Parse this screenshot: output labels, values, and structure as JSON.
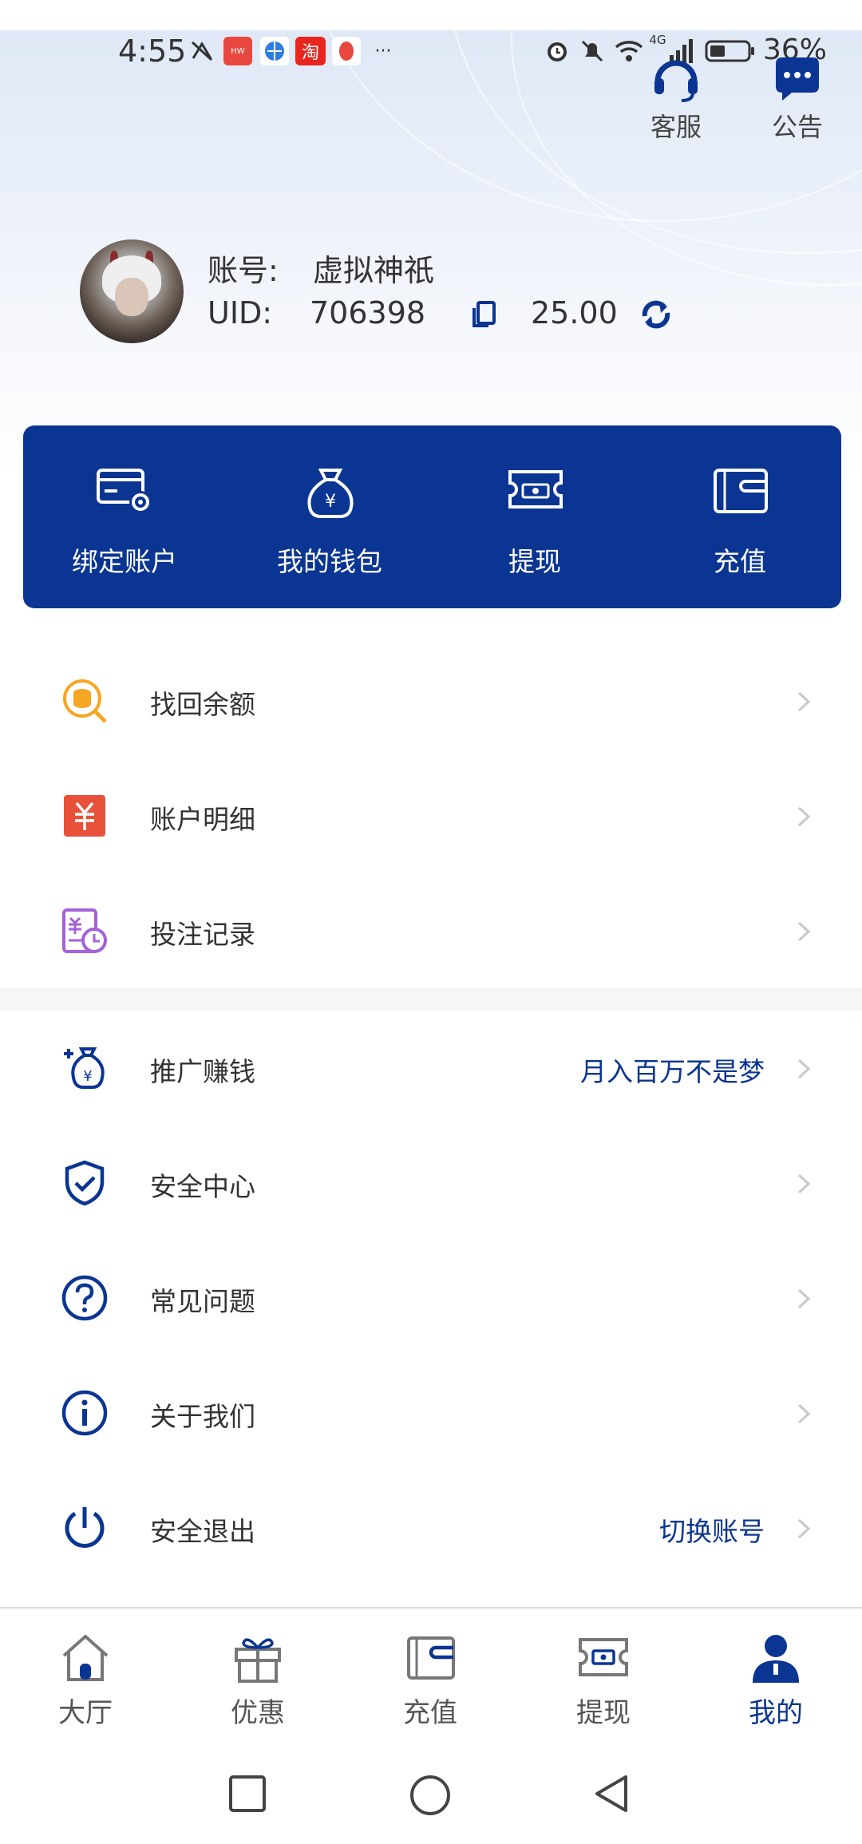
{
  "status_bar": {
    "time": "4:55",
    "battery": "36%",
    "network": "4G",
    "more": "···",
    "app_icons": [
      "silent-mode-icon",
      "huawei-app-icon",
      "browser-app-icon",
      "taobao-app-icon",
      "red-app-icon"
    ],
    "system_icons": [
      "alarm-icon",
      "mute-icon",
      "wifi-icon",
      "signal-icon",
      "battery-icon"
    ]
  },
  "header": {
    "service_label": "客服",
    "notice_label": "公告"
  },
  "profile": {
    "account_label": "账号:",
    "account_name": "虚拟神祇",
    "uid_label": "UID:",
    "uid_value": "706398",
    "balance": "25.00"
  },
  "quick_actions": [
    {
      "label": "绑定账户",
      "icon": "card-gear-icon"
    },
    {
      "label": "我的钱包",
      "icon": "money-bag-icon"
    },
    {
      "label": "提现",
      "icon": "ticket-icon"
    },
    {
      "label": "充值",
      "icon": "wallet-icon"
    }
  ],
  "menu": [
    {
      "label": "找回余额",
      "extra": "",
      "icon": "coin-search-icon"
    },
    {
      "label": "账户明细",
      "extra": "",
      "icon": "yuan-ledger-icon"
    },
    {
      "label": "投注记录",
      "extra": "",
      "icon": "bet-record-icon"
    },
    {
      "label": "推广赚钱",
      "extra": "月入百万不是梦",
      "icon": "money-bag-plus-icon"
    },
    {
      "label": "安全中心",
      "extra": "",
      "icon": "shield-check-icon"
    },
    {
      "label": "常见问题",
      "extra": "",
      "icon": "question-icon"
    },
    {
      "label": "关于我们",
      "extra": "",
      "icon": "info-icon"
    },
    {
      "label": "安全退出",
      "extra": "切换账号",
      "icon": "power-icon"
    }
  ],
  "tabs": [
    {
      "label": "大厅",
      "icon": "home-icon",
      "active": false
    },
    {
      "label": "优惠",
      "icon": "gift-icon",
      "active": false
    },
    {
      "label": "充值",
      "icon": "wallet-icon",
      "active": false
    },
    {
      "label": "提现",
      "icon": "ticket-icon",
      "active": false
    },
    {
      "label": "我的",
      "icon": "user-icon",
      "active": true
    }
  ],
  "colors": {
    "brand": "#0a3592",
    "accent_text": "#0a3592",
    "coin": "#f5a623",
    "ledger": "#e8503a",
    "record": "#a461d8"
  }
}
